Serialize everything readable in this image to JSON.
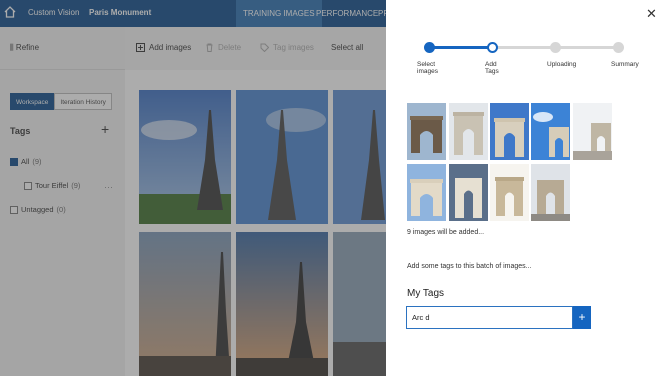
{
  "topbar": {
    "home_icon": "home-icon",
    "app_name": "Custom Vision",
    "project_name": "Paris Monument",
    "tabs": [
      {
        "label": "TRAINING IMAGES",
        "active": true
      },
      {
        "label": "PERFORMANCE",
        "active": false
      },
      {
        "label": "PR",
        "active": false
      }
    ]
  },
  "sidebar": {
    "refine_label": "Refine",
    "view_buttons": [
      {
        "label": "Workspace",
        "active": true
      },
      {
        "label": "Iteration History",
        "active": false
      }
    ],
    "tags_heading": "Tags",
    "add_icon": "plus-icon",
    "tags": [
      {
        "label": "All",
        "count": "(9)",
        "checked": true
      },
      {
        "label": "Tour Eiffel",
        "count": "(9)",
        "checked": false
      },
      {
        "label": "Untagged",
        "count": "(0)",
        "checked": false
      }
    ],
    "more_label": "···"
  },
  "toolbar": {
    "add_images": "Add images",
    "delete": "Delete",
    "tag_images": "Tag images",
    "select_all": "Select all"
  },
  "panel": {
    "close_icon": "close-icon",
    "steps": [
      {
        "label": "Select images",
        "state": "done"
      },
      {
        "label": "Add Tags",
        "state": "current"
      },
      {
        "label": "Uploading",
        "state": "pending"
      },
      {
        "label": "Summary",
        "state": "pending"
      }
    ],
    "images_count_text": "9 images will be added...",
    "instruction": "Add some tags to this batch of images...",
    "my_tags_label": "My Tags",
    "tag_input_value": "Arc d",
    "add_tag_icon": "plus-icon"
  },
  "colors": {
    "brand": "#0f4c8a",
    "accent": "#1565c0",
    "step_active": "#1565c0",
    "step_pending": "#d6d6d6"
  }
}
